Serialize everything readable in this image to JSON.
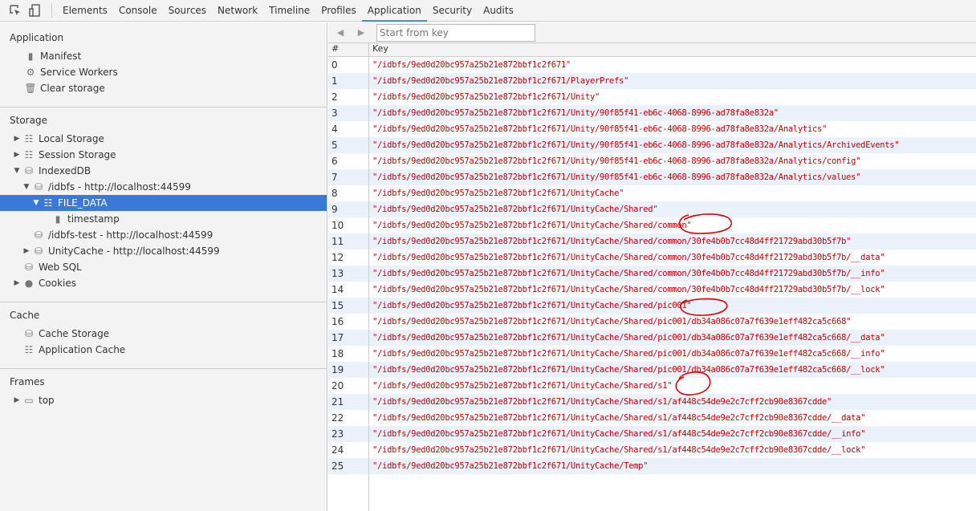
{
  "toolbar": {
    "tabs": [
      "Elements",
      "Console",
      "Sources",
      "Network",
      "Timeline",
      "Profiles",
      "Application",
      "Security",
      "Audits"
    ],
    "active_tab": "Application"
  },
  "sidebar": {
    "application": {
      "title": "Application",
      "items": [
        "Manifest",
        "Service Workers",
        "Clear storage"
      ]
    },
    "storage": {
      "title": "Storage",
      "local": "Local Storage",
      "session": "Session Storage",
      "indexeddb": "IndexedDB",
      "idbfs": "/idbfs - http://localhost:44599",
      "file_data": "FILE_DATA",
      "timestamp": "timestamp",
      "idbfs_test": "/idbfs-test - http://localhost:44599",
      "unitycache": "UnityCache - http://localhost:44599",
      "websql": "Web SQL",
      "cookies": "Cookies"
    },
    "cache": {
      "title": "Cache",
      "items": [
        "Cache Storage",
        "Application Cache"
      ]
    },
    "frames": {
      "title": "Frames",
      "top": "top"
    }
  },
  "main": {
    "search_placeholder": "Start from key",
    "columns": [
      "#",
      "Key"
    ],
    "rows": [
      "\"/idbfs/9ed0d20bc957a25b21e872bbf1c2f671\"",
      "\"/idbfs/9ed0d20bc957a25b21e872bbf1c2f671/PlayerPrefs\"",
      "\"/idbfs/9ed0d20bc957a25b21e872bbf1c2f671/Unity\"",
      "\"/idbfs/9ed0d20bc957a25b21e872bbf1c2f671/Unity/90f85f41-eb6c-4068-8996-ad78fa8e832a\"",
      "\"/idbfs/9ed0d20bc957a25b21e872bbf1c2f671/Unity/90f85f41-eb6c-4068-8996-ad78fa8e832a/Analytics\"",
      "\"/idbfs/9ed0d20bc957a25b21e872bbf1c2f671/Unity/90f85f41-eb6c-4068-8996-ad78fa8e832a/Analytics/ArchivedEvents\"",
      "\"/idbfs/9ed0d20bc957a25b21e872bbf1c2f671/Unity/90f85f41-eb6c-4068-8996-ad78fa8e832a/Analytics/config\"",
      "\"/idbfs/9ed0d20bc957a25b21e872bbf1c2f671/Unity/90f85f41-eb6c-4068-8996-ad78fa8e832a/Analytics/values\"",
      "\"/idbfs/9ed0d20bc957a25b21e872bbf1c2f671/UnityCache\"",
      "\"/idbfs/9ed0d20bc957a25b21e872bbf1c2f671/UnityCache/Shared\"",
      "\"/idbfs/9ed0d20bc957a25b21e872bbf1c2f671/UnityCache/Shared/common\"",
      "\"/idbfs/9ed0d20bc957a25b21e872bbf1c2f671/UnityCache/Shared/common/30fe4b0b7cc48d4ff21729abd30b5f7b\"",
      "\"/idbfs/9ed0d20bc957a25b21e872bbf1c2f671/UnityCache/Shared/common/30fe4b0b7cc48d4ff21729abd30b5f7b/__data\"",
      "\"/idbfs/9ed0d20bc957a25b21e872bbf1c2f671/UnityCache/Shared/common/30fe4b0b7cc48d4ff21729abd30b5f7b/__info\"",
      "\"/idbfs/9ed0d20bc957a25b21e872bbf1c2f671/UnityCache/Shared/common/30fe4b0b7cc48d4ff21729abd30b5f7b/__lock\"",
      "\"/idbfs/9ed0d20bc957a25b21e872bbf1c2f671/UnityCache/Shared/pic001\"",
      "\"/idbfs/9ed0d20bc957a25b21e872bbf1c2f671/UnityCache/Shared/pic001/db34a086c07a7f639e1eff482ca5c668\"",
      "\"/idbfs/9ed0d20bc957a25b21e872bbf1c2f671/UnityCache/Shared/pic001/db34a086c07a7f639e1eff482ca5c668/__data\"",
      "\"/idbfs/9ed0d20bc957a25b21e872bbf1c2f671/UnityCache/Shared/pic001/db34a086c07a7f639e1eff482ca5c668/__info\"",
      "\"/idbfs/9ed0d20bc957a25b21e872bbf1c2f671/UnityCache/Shared/pic001/db34a086c07a7f639e1eff482ca5c668/__lock\"",
      "\"/idbfs/9ed0d20bc957a25b21e872bbf1c2f671/UnityCache/Shared/s1\"",
      "\"/idbfs/9ed0d20bc957a25b21e872bbf1c2f671/UnityCache/Shared/s1/af448c54de9e2c7cff2cb90e8367cdde\"",
      "\"/idbfs/9ed0d20bc957a25b21e872bbf1c2f671/UnityCache/Shared/s1/af448c54de9e2c7cff2cb90e8367cdde/__data\"",
      "\"/idbfs/9ed0d20bc957a25b21e872bbf1c2f671/UnityCache/Shared/s1/af448c54de9e2c7cff2cb90e8367cdde/__info\"",
      "\"/idbfs/9ed0d20bc957a25b21e872bbf1c2f671/UnityCache/Shared/s1/af448c54de9e2c7cff2cb90e8367cdde/__lock\"",
      "\"/idbfs/9ed0d20bc957a25b21e872bbf1c2f671/UnityCache/Temp\""
    ]
  },
  "colors": {
    "accent": "#3879d9",
    "key_text": "#c80000",
    "annotation": "#e00000",
    "row_alt": "#eaf1fb"
  }
}
